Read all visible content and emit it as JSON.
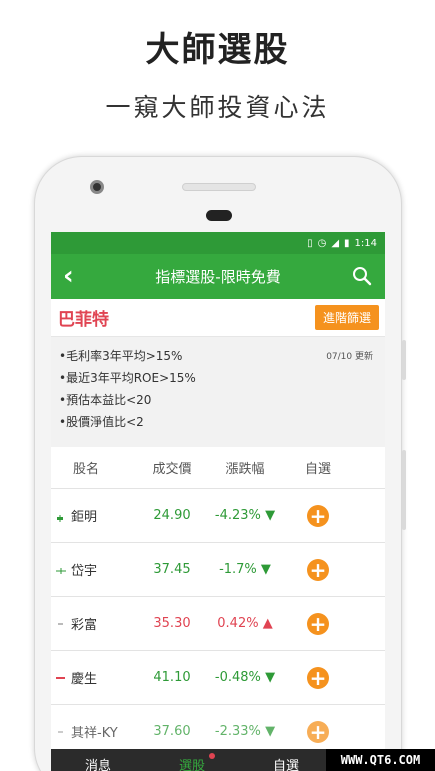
{
  "promo": {
    "title": "大師選股",
    "subtitle": "一窺大師投資心法"
  },
  "status_bar": {
    "icons": [
      "vibrate-icon",
      "alarm-icon",
      "lte-signal-icon",
      "battery-icon"
    ],
    "time": "1:14"
  },
  "app_bar": {
    "title": "指標選股-限時免費",
    "back_icon": "back-arrow-icon",
    "search_icon": "search-icon"
  },
  "guru": {
    "name": "巴菲特",
    "advanced_button": "進階篩選"
  },
  "criteria": {
    "items": [
      "•毛利率3年平均>15%",
      "•最近3年平均ROE>15%",
      "•預估本益比<20",
      "•股價淨值比<2"
    ],
    "updated": "07/10 更新"
  },
  "table": {
    "headers": {
      "name": "股名",
      "price": "成交價",
      "change": "漲跌幅",
      "fav": "自選"
    },
    "rows": [
      {
        "name": "鉅明",
        "price": "24.90",
        "change": "-4.23%",
        "arrow": "▼",
        "direction": "down"
      },
      {
        "name": "岱宇",
        "price": "37.45",
        "change": "-1.7%",
        "arrow": "▼",
        "direction": "down"
      },
      {
        "name": "彩富",
        "price": "35.30",
        "change": "0.42%",
        "arrow": "▲",
        "direction": "up"
      },
      {
        "name": "慶生",
        "price": "41.10",
        "change": "-0.48%",
        "arrow": "▼",
        "direction": "down"
      },
      {
        "name": "其祥-KY",
        "price": "37.60",
        "change": "-2.33%",
        "arrow": "▼",
        "direction": "down"
      }
    ],
    "add_label": "+"
  },
  "bottom_nav": {
    "items": [
      "消息",
      "選股",
      "自選"
    ],
    "active_index": 1
  },
  "watermark": "WWW.QT6.COM",
  "colors": {
    "brand_green": "#35a93e",
    "status_green": "#2e9a37",
    "accent_orange": "#f5921e",
    "up_red": "#e04452",
    "down_green": "#2e9a37"
  }
}
